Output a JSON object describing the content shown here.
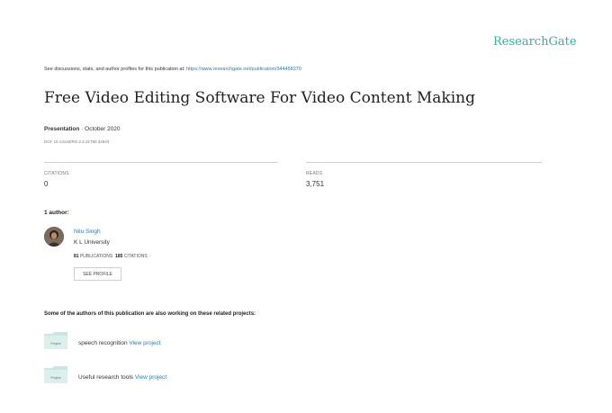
{
  "brand": "ResearchGate",
  "top_note": {
    "text": "See discussions, stats, and author profiles for this publication at:",
    "url": "https://www.researchgate.net/publication/344458270"
  },
  "title": "Free Video Editing Software For Video Content Making",
  "meta": {
    "type": "Presentation",
    "date": " · October 2020",
    "doi": "DOI: 10.13140/RG.2.2.21780.32643"
  },
  "stats": {
    "citations_label": "CITATIONS",
    "citations_value": "0",
    "reads_label": "READS",
    "reads_value": "3,751"
  },
  "authors_heading": "1 author:",
  "author": {
    "name": "Nilu Singh",
    "affiliation": "K L University",
    "publications_count": "81",
    "publications_label": "PUBLICATIONS",
    "citations_count": "185",
    "citations_label": "CITATIONS",
    "see_profile": "SEE PROFILE"
  },
  "related_heading": "Some of the authors of this publication are also working on these related projects:",
  "projects": [
    {
      "badge": "Project",
      "name": "speech recognition",
      "link": "View project"
    },
    {
      "badge": "Project",
      "name": "Useful research tools",
      "link": "View project"
    }
  ],
  "colors": {
    "brand": "#2bb3a5",
    "link": "#2a7ab8",
    "folder": "#c9e6e2"
  }
}
